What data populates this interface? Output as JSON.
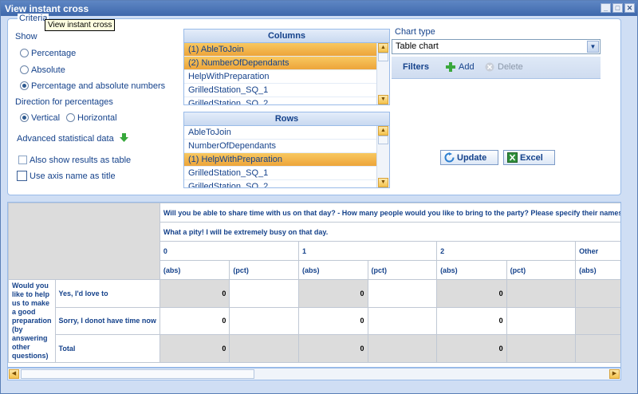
{
  "window": {
    "title": "View instant cross",
    "tooltip": "View instant cross",
    "min_label": "_",
    "max_label": "□",
    "close_label": "✕"
  },
  "criteria": {
    "legend": "Criteria",
    "show_label": "Show",
    "show_options": [
      "Percentage",
      "Absolute",
      "Percentage and absolute numbers"
    ],
    "show_selected": "Percentage and absolute numbers",
    "direction_label": "Direction for percentages",
    "direction_options": [
      "Vertical",
      "Horizontal"
    ],
    "direction_selected": "Vertical",
    "advanced_label": "Advanced statistical data",
    "also_show_table": "Also show results as table",
    "use_axis_name": "Use axis name as title"
  },
  "columns_panel": {
    "title": "Columns",
    "items": [
      "(1) AbleToJoin",
      "(2) NumberOfDependants",
      "HelpWithPreparation",
      "GrilledStation_SQ_1",
      "GrilledStation_SQ_2"
    ],
    "selected": [
      0,
      1
    ]
  },
  "rows_panel": {
    "title": "Rows",
    "items": [
      "AbleToJoin",
      "NumberOfDependants",
      "(1) HelpWithPreparation",
      "GrilledStation_SQ_1",
      "GrilledStation_SQ_2"
    ],
    "selected": [
      2
    ]
  },
  "chart": {
    "type_label": "Chart type",
    "type_value": "Table chart"
  },
  "filters": {
    "label": "Filters",
    "add_label": "Add",
    "delete_label": "Delete"
  },
  "buttons": {
    "update": "Update",
    "excel": "Excel"
  },
  "results": {
    "header1": "Will you be able to share time with us on that day? - How many people would you like to bring to the party? Please specify their names",
    "header2": "What a pity! I will be extremely busy on that day.",
    "groups": [
      "0",
      "1",
      "2",
      "Other"
    ],
    "measure_abs": "(abs)",
    "measure_pct": "(pct)",
    "row_question": "Would you like to help us to make a good preparation (by answering other questions)",
    "rows": [
      {
        "label": "Yes, I'd love to",
        "values": [
          "0",
          "",
          "0",
          "",
          "0",
          "",
          ""
        ]
      },
      {
        "label": "Sorry, I donot have time now",
        "values": [
          "0",
          "",
          "0",
          "",
          "0",
          "",
          ""
        ]
      },
      {
        "label": "Total",
        "values": [
          "0",
          "",
          "0",
          "",
          "0",
          "",
          ""
        ]
      }
    ]
  },
  "colors": {
    "accent": "#15428b",
    "selected_row": "#f5b74a",
    "panel_bg": "#cfdef4"
  }
}
